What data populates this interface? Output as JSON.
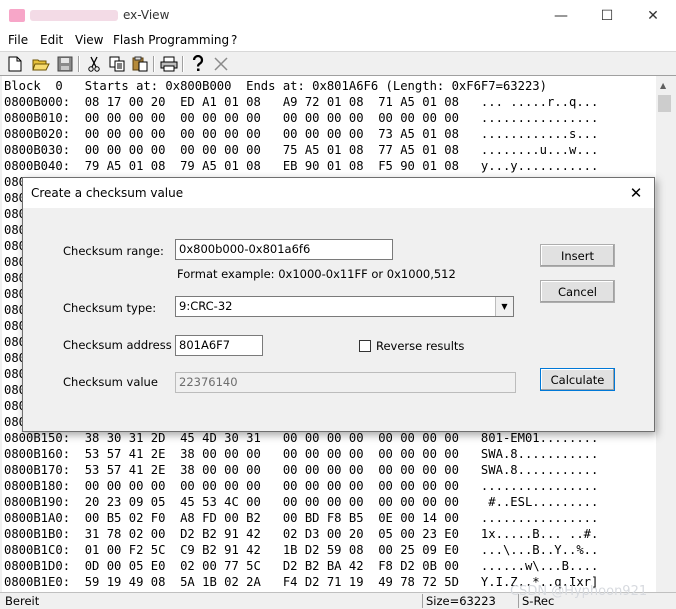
{
  "window": {
    "title": "ex-View",
    "minimize": "—",
    "maximize": "☐",
    "close": "✕"
  },
  "menu": [
    "File",
    "Edit",
    "View",
    "Flash Programming",
    "?"
  ],
  "toolbar_icons": [
    "new-icon",
    "open-icon",
    "save-icon",
    "cut-icon",
    "copy-icon",
    "paste-icon",
    "print-icon",
    "help-icon",
    "close-icon"
  ],
  "hex": {
    "header": "Block  0   Starts at: 0x800B000  Ends at: 0x801A6F6 (Length: 0xF6F7=63223)",
    "lines_top": [
      "0800B000:  08 17 00 20  ED A1 01 08   A9 72 01 08  71 A5 01 08   ... .....r..q...",
      "0800B010:  00 00 00 00  00 00 00 00   00 00 00 00  00 00 00 00   ................",
      "0800B020:  00 00 00 00  00 00 00 00   00 00 00 00  73 A5 01 08   ............s...",
      "0800B030:  00 00 00 00  00 00 00 00   75 A5 01 08  77 A5 01 08   ........u...w...",
      "0800B040:  79 A5 01 08  79 A5 01 08   EB 90 01 08  F5 90 01 08   y...y..........."
    ],
    "hidden_prefix": "080",
    "lines_bottom": [
      "0800B150:  38 30 31 2D  45 4D 30 31   00 00 00 00  00 00 00 00   801-EM01........",
      "0800B160:  53 57 41 2E  38 00 00 00   00 00 00 00  00 00 00 00   SWA.8...........",
      "0800B170:  53 57 41 2E  38 00 00 00   00 00 00 00  00 00 00 00   SWA.8...........",
      "0800B180:  00 00 00 00  00 00 00 00   00 00 00 00  00 00 00 00   ................",
      "0800B190:  20 23 09 05  45 53 4C 00   00 00 00 00  00 00 00 00    #..ESL.........",
      "0800B1A0:  00 B5 02 F0  A8 FD 00 B2   00 BD F8 B5  0E 00 14 00   ................",
      "0800B1B0:  31 78 02 00  D2 B2 91 42   02 D3 00 20  05 00 23 E0   1x.....B... ..#.",
      "0800B1C0:  01 00 F2 5C  C9 B2 91 42   1B D2 59 08  00 25 09 E0   ...\\...B..Y..%..",
      "0800B1D0:  0D 00 05 E0  02 00 77 5C   D2 B2 BA 42  F8 D2 0B 00   ......w\\...B....",
      "0800B1E0:  59 19 49 08  5A 1B 02 2A   F4 D2 71 19  49 78 72 5D   Y.I.Z..*..q.Ixr]"
    ]
  },
  "status": {
    "state": "Bereit",
    "size": "Size=63223",
    "format": "S-Rec"
  },
  "dialog": {
    "title": "Create a checksum value",
    "range_label": "Checksum range:",
    "range_value": "0x800b000-0x801a6f6",
    "format_example": "Format example: 0x1000-0x11FF or 0x1000,512",
    "type_label": "Checksum type:",
    "type_value": "9:CRC-32",
    "address_label": "Checksum address",
    "address_value": "801A6F7",
    "reverse_label": "Reverse results",
    "value_label": "Checksum value",
    "value_value": "22376140",
    "insert_label": "Insert",
    "cancel_label": "Cancel",
    "calculate_label": "Calculate"
  },
  "watermark": "CSDN @Hyphoon921"
}
